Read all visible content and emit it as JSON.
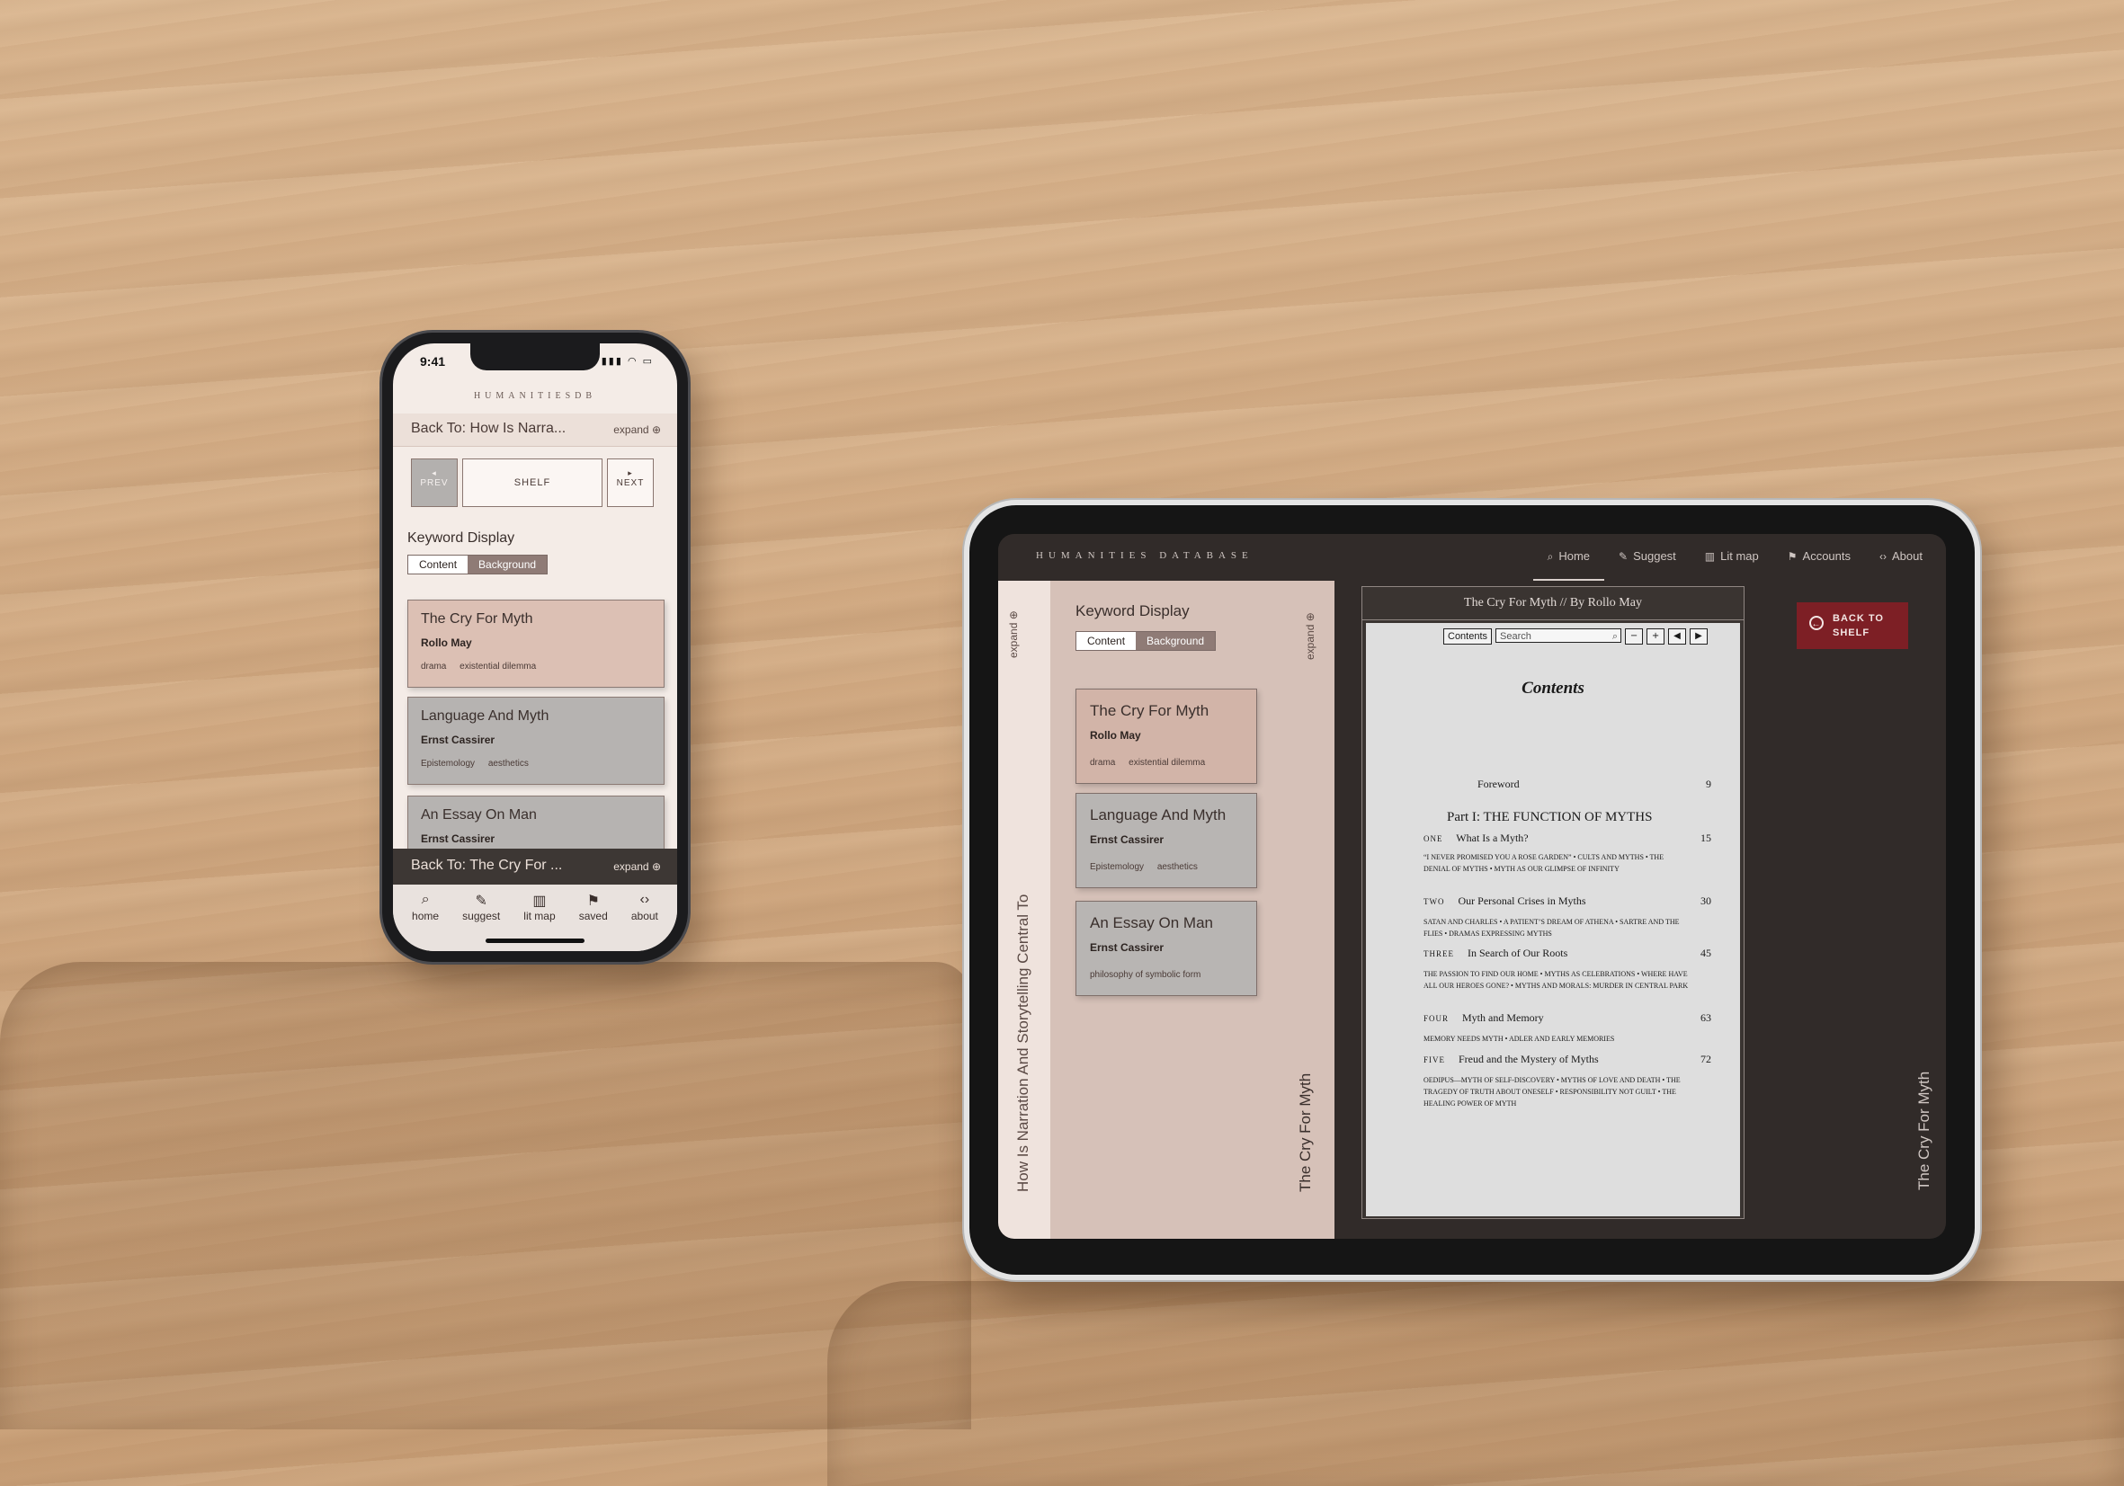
{
  "phone": {
    "status_time": "9:41",
    "brand": "HUMANITIESDB",
    "back_text": "Back To: How Is Narra...",
    "expand": "expand",
    "prev": "PREV",
    "shelf": "SHELF",
    "next": "NEXT",
    "keyword_display": "Keyword Display",
    "toggle": {
      "content": "Content",
      "background": "Background"
    },
    "cards": [
      {
        "title": "The Cry For Myth",
        "author": "Rollo May",
        "keywords": [
          "drama",
          "existential dilemma"
        ]
      },
      {
        "title": "Language And Myth",
        "author": "Ernst Cassirer",
        "keywords": [
          "Epistemology",
          "aesthetics"
        ]
      },
      {
        "title": "An Essay On Man",
        "author": "Ernst Cassirer",
        "keywords": []
      }
    ],
    "bottom_back": "Back To: The Cry For ...",
    "bottom_expand": "expand",
    "tabs": [
      {
        "label": "home",
        "icon": "search-icon"
      },
      {
        "label": "suggest",
        "icon": "suggest-icon"
      },
      {
        "label": "lit map",
        "icon": "map-icon"
      },
      {
        "label": "saved",
        "icon": "bookmark-icon"
      },
      {
        "label": "about",
        "icon": "code-icon"
      }
    ]
  },
  "tablet": {
    "brand": "HUMANITIES DATABASE",
    "nav": [
      {
        "label": "Home",
        "icon": "search-icon",
        "active": true
      },
      {
        "label": "Suggest",
        "icon": "suggest-icon"
      },
      {
        "label": "Lit map",
        "icon": "map-icon"
      },
      {
        "label": "Accounts",
        "icon": "bookmark-icon"
      },
      {
        "label": "About",
        "icon": "code-icon"
      }
    ],
    "left_strip": {
      "expand": "expand",
      "vertical_title": "How Is Narration And Storytelling Central To"
    },
    "panel": {
      "keyword_display": "Keyword Display",
      "toggle": {
        "content": "Content",
        "background": "Background"
      },
      "expand": "expand",
      "vertical_title": "The Cry For Myth",
      "cards": [
        {
          "title": "The Cry For Myth",
          "author": "Rollo May",
          "keywords": [
            "drama",
            "existential dilemma"
          ]
        },
        {
          "title": "Language And Myth",
          "author": "Ernst Cassirer",
          "keywords": [
            "Epistemology",
            "aesthetics"
          ]
        },
        {
          "title": "An Essay On Man",
          "author": "Ernst Cassirer",
          "keywords": [
            "philosophy of symbolic form"
          ]
        }
      ]
    },
    "reader": {
      "header": "The Cry For Myth // By Rollo May",
      "toolbar": {
        "contents": "Contents",
        "search_placeholder": "Search"
      },
      "doc_title": "Contents",
      "foreword": "Foreword",
      "foreword_page": "9",
      "part": "Part I: THE FUNCTION OF MYTHS",
      "chapters": [
        {
          "num": "ONE",
          "title": "What Is a Myth?",
          "page": "15",
          "sub": "“I never promised you a rose garden” • cults and myths • the denial of myths • myth as our glimpse of infinity"
        },
        {
          "num": "TWO",
          "title": "Our Personal Crises in Myths",
          "page": "30",
          "sub": "Satan and Charles • a patient’s dream of Athena • Sartre and The Flies • dramas expressing myths"
        },
        {
          "num": "THREE",
          "title": "In Search of Our Roots",
          "page": "45",
          "sub": "The passion to find our home • myths as celebrations • where have all our heroes gone? • myths and morals: murder in central park"
        },
        {
          "num": "FOUR",
          "title": "Myth and Memory",
          "page": "63",
          "sub": "Memory needs myth • Adler and early memories"
        },
        {
          "num": "FIVE",
          "title": "Freud and the Mystery of Myths",
          "page": "72",
          "sub": "Oedipus—myth of self-discovery • myths of love and death • the tragedy of truth about oneself • responsibility not guilt • the healing power of myth"
        }
      ]
    },
    "back_to_shelf": "BACK TO SHELF",
    "right_vertical_title": "The Cry For Myth"
  }
}
